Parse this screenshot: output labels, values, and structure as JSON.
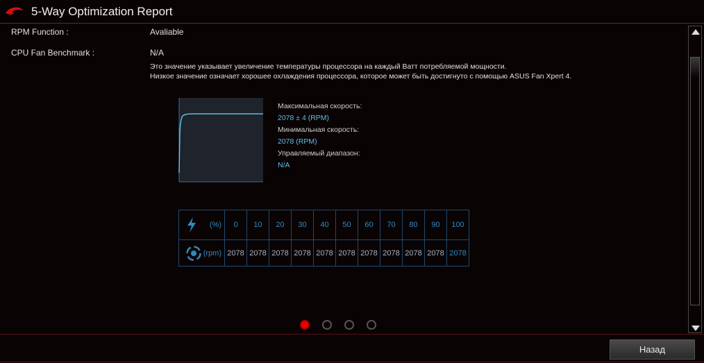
{
  "window": {
    "title": "5-Way Optimization Report"
  },
  "fields": [
    {
      "label": "RPM Function :",
      "value": "Avaliable"
    },
    {
      "label": "CPU Fan Benchmark :",
      "value": "N/A"
    }
  ],
  "description": [
    "Это значение указывает увеличение температуры процессора на каждый Ватт потребляемой мощности.",
    "Низкое значение означает хорошее охлаждения процессора, которое может быть достигнуто с помощью ASUS Fan Xpert 4."
  ],
  "info": {
    "max_label": "Максимальная скорость:",
    "max_value": "2078 ± 4 (RPM)",
    "min_label": "Минимальная скорость:",
    "min_value": "2078 (RPM)",
    "range_label": "Управляемый диапазон:",
    "range_value": "N/A"
  },
  "table": {
    "power_unit": "(%)",
    "rpm_unit": "(rpm)",
    "percent": [
      "0",
      "10",
      "20",
      "30",
      "40",
      "50",
      "60",
      "70",
      "80",
      "90",
      "100"
    ],
    "rpm": [
      "2078",
      "2078",
      "2078",
      "2078",
      "2078",
      "2078",
      "2078",
      "2078",
      "2078",
      "2078",
      "2078"
    ]
  },
  "pager": {
    "pages": 4,
    "active": 0
  },
  "buttons": {
    "back": "Назад"
  },
  "colors": {
    "accent": "#e00000",
    "data": "#5cc0e8",
    "grid": "#1d4a70"
  }
}
